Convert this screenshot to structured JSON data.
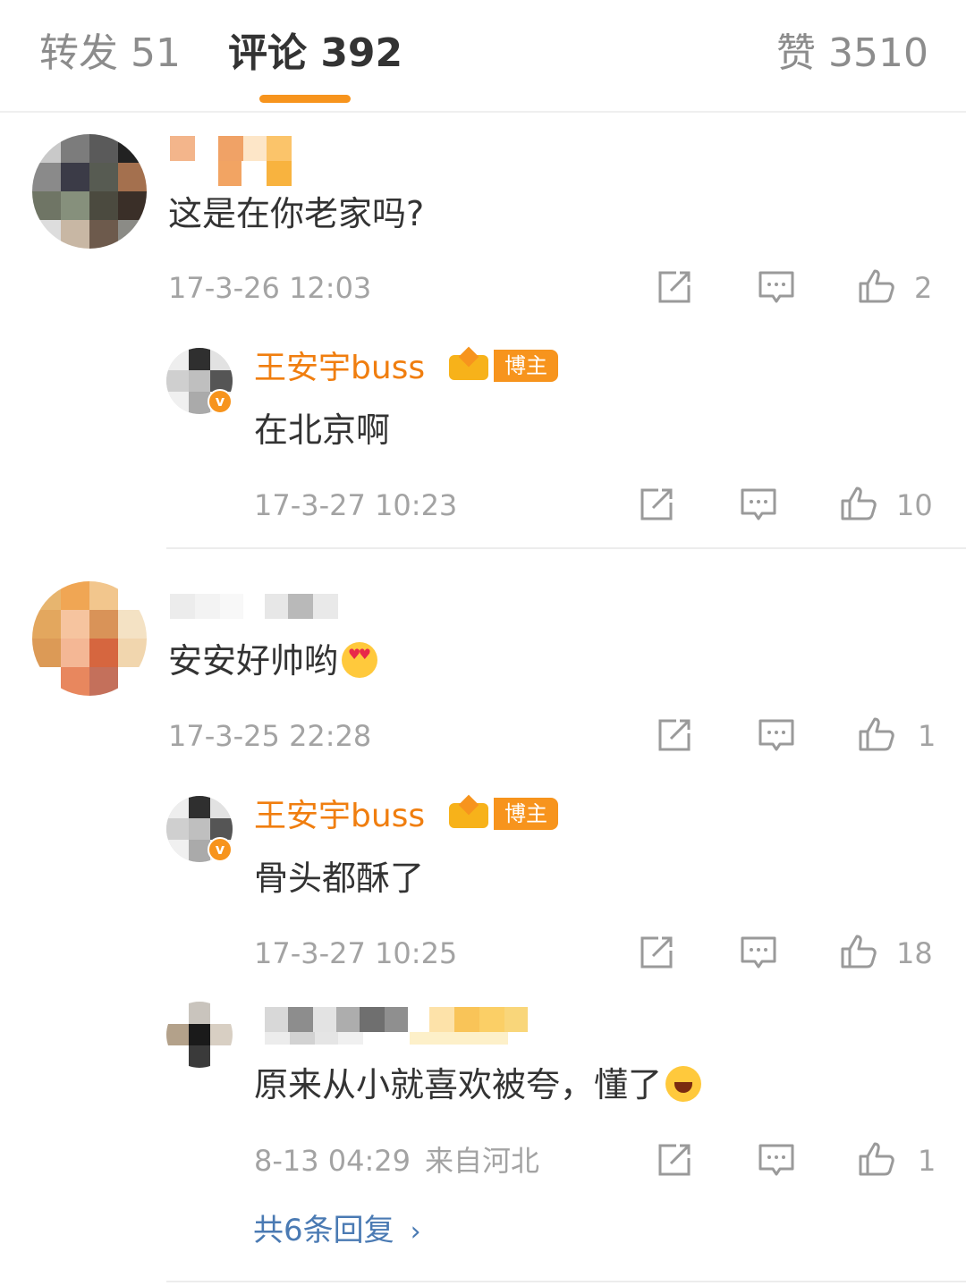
{
  "tabs": {
    "repost": "转发 51",
    "comments": "评论 392",
    "likes": "赞 3510"
  },
  "comments": [
    {
      "text": "这是在你老家吗?",
      "time": "17-3-26 12:03",
      "likes": "2",
      "reply": {
        "user": "王安宇buss",
        "badge": "博主",
        "text": "在北京啊",
        "time": "17-3-27 10:23",
        "likes": "10"
      }
    },
    {
      "text": "安安好帅哟",
      "emoji": "heart-eyes-emoji",
      "time": "17-3-25 22:28",
      "likes": "1",
      "reply": {
        "user": "王安宇buss",
        "badge": "博主",
        "text": "骨头都酥了",
        "time": "17-3-27 10:25",
        "likes": "18"
      },
      "reply2": {
        "text": "原来从小就喜欢被夸，懂了",
        "emoji": "grin-emoji",
        "time": "8-13 04:29",
        "location": "来自河北",
        "likes": "1"
      },
      "more": "共6条回复"
    }
  ],
  "colors": {
    "accent": "#f7941d",
    "username": "#f07e0f",
    "link": "#4a7ab3",
    "meta": "#a3a3a3"
  },
  "icons": [
    "forward-icon",
    "comment-icon",
    "like-icon",
    "chevron-right-icon",
    "verified-icon"
  ]
}
